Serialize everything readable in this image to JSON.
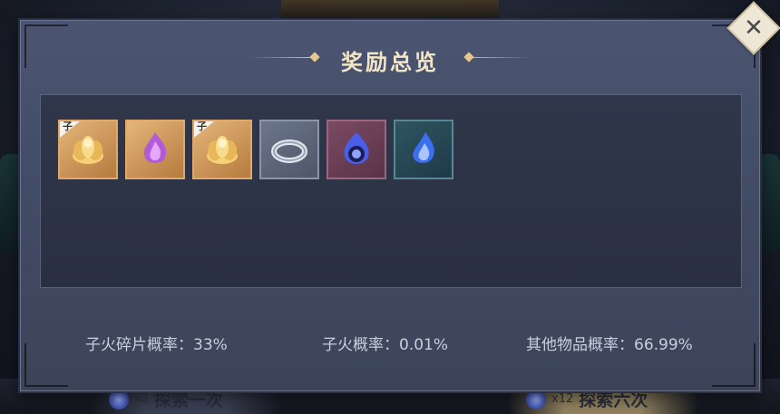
{
  "dialog": {
    "title": "奖励总览",
    "close_icon": "close-icon",
    "stats": [
      {
        "label": "子火碎片概率：33%"
      },
      {
        "label": "子火概率：0.01%"
      },
      {
        "label": "其他物品概率：66.99%"
      }
    ]
  },
  "rewards": [
    {
      "icon": "golden-lotus-icon",
      "rarity": "gold",
      "badge": "子"
    },
    {
      "icon": "purple-flame-icon",
      "rarity": "gold",
      "badge": ""
    },
    {
      "icon": "golden-lotus-icon",
      "rarity": "gold",
      "badge": "子"
    },
    {
      "icon": "silver-ring-icon",
      "rarity": "gray",
      "badge": ""
    },
    {
      "icon": "blue-flame-orb-icon",
      "rarity": "red",
      "badge": ""
    },
    {
      "icon": "blue-flame-icon",
      "rarity": "blue",
      "badge": ""
    }
  ],
  "footer": {
    "explore_once": {
      "count": "x2",
      "label": "探索一次"
    },
    "explore_six": {
      "count": "x12",
      "label": "探索六次"
    }
  },
  "colors": {
    "title": "#f3e6c8",
    "panel": "#414a63",
    "accent_gold": "#e3c58e"
  }
}
